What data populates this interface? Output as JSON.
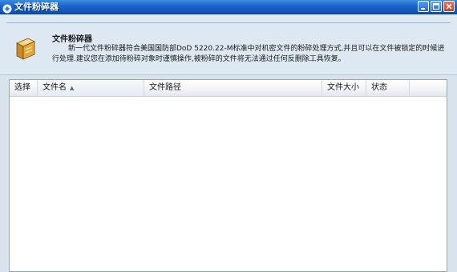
{
  "window": {
    "title": "文件粉碎器"
  },
  "header": {
    "title": "文件粉碎器",
    "description": "新一代文件粉碎器符合美国国防部DoD 5220.22-M标准中对机密文件的粉碎处理方式,并且可以在文件被锁定的时候进行处理.建议您在添加待粉碎对象时谨慎操作,被粉碎的文件将无法通过任何反删除工具恢复。",
    "icon": "shredder-icon"
  },
  "table": {
    "columns": [
      "选择",
      "文件名",
      "文件路径",
      "文件大小",
      "状态"
    ],
    "sorted_column": "文件名",
    "rows": []
  },
  "colors": {
    "titlebar": "#1c63c8",
    "header_bg": "#dde8f3",
    "table_bg": "#ffffff"
  }
}
